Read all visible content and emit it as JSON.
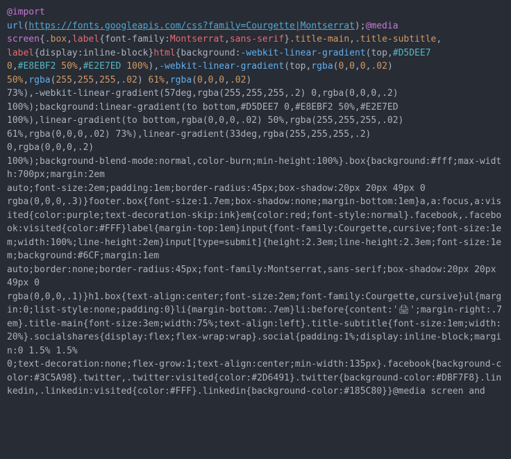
{
  "code": {
    "import_kw": "@import",
    "url_fn": "url",
    "url_str": "https://fonts.googleapis.com/css?family=Courgette|Montserrat",
    "media_kw": "@media",
    "screen_kw": "screen",
    "sel_box": ".box",
    "sel_label": "label",
    "font_family_prop": "font-family",
    "font_val_mont": "Montserrat",
    "font_val_sans": "sans-serif",
    "sel_title_main": ".title-main",
    "sel_title_sub": ".title-subtitle",
    "display_prop": "display",
    "inline_block": "inline-block",
    "sel_html": "html",
    "background_prop": "background",
    "webkit_lg": "-webkit-linear-gradient",
    "top": "top",
    "col_d5dee7": "#D5DEE7",
    "zero": "0",
    "col_e8ebf2": "#E8EBF2",
    "pct_50": "50%",
    "col_e2e7ed": "#E2E7ED",
    "pct_100": "100%",
    "rgba_fn": "rgba",
    "r0": "0",
    "r255": "255",
    "a02": ".02",
    "a2": ".2",
    "pct_61": "61%",
    "pct_73": "73%",
    "deg_57": "57deg",
    "linear_gradient": "linear-gradient",
    "to_bottom": "to bottom",
    "deg_33": "33deg",
    "bg_blend": "background-blend-mode",
    "normal": "normal",
    "color_burn": "color-burn",
    "min_height": "min-height",
    "bg_short": "background",
    "col_fff": "#fff",
    "max_width": "max-width",
    "px_700": "700px",
    "margin_prop": "margin",
    "em_2": "2em",
    "auto": "auto",
    "font_size_prop": "font-size",
    "padding_prop": "padding",
    "em_1": "1em",
    "border_radius": "border-radius",
    "px_45": "45px",
    "box_shadow": "box-shadow",
    "px_20": "20px",
    "px_49": "49px",
    "a3": ".3",
    "sel_footer_box": "footer.box",
    "em_17": "1.7em",
    "none": "none",
    "margin_bottom": "margin-bottom",
    "sel_a": "a",
    "sel_a_focus": "a:focus",
    "sel_a_visited": "a:visited",
    "color_prop": "color",
    "purple": "purple",
    "text_dec_skip": "text-decoration-skip",
    "ink": "ink",
    "sel_em": "em",
    "red": "red",
    "font_style": "font-style",
    "sel_facebook": ".facebook",
    "sel_facebook_vis": ".facebook:visited",
    "col_FFF": "#FFF",
    "margin_top": "margin-top",
    "sel_input": "input",
    "courgette": "Courgette",
    "cursive": "cursive",
    "width_prop": "width",
    "line_height": "line-height",
    "sel_submit": "input[type=submit]",
    "height_prop": "height",
    "em_23": "2.3em",
    "col_6cf": "#6CF",
    "border_prop": "border",
    "a1": ".1",
    "sel_h1box": "h1.box",
    "text_align": "text-align",
    "center": "center",
    "sel_ul": "ul",
    "list_style": "list-style",
    "sel_li": "li",
    "em_07": ".7em",
    "sel_li_before": "li:before",
    "content_prop": "content",
    "printer_emoji": "'🖨'",
    "margin_right": "margin-right",
    "em_3": "3em",
    "pct_75": "75%",
    "left": "left",
    "pct_20": "20%",
    "sel_socials": ".socialshares",
    "flex": "flex",
    "flex_wrap": "flex-wrap",
    "wrap": "wrap",
    "sel_social": ".social",
    "pct_1": "1%",
    "pct_15": "1.5%",
    "text_dec": "text-decoration",
    "flex_grow": "flex-grow",
    "one": "1",
    "min_width": "min-width",
    "px_135": "135px",
    "bg_color": "background-color",
    "col_3c5a98": "#3C5A98",
    "sel_twitter": ".twitter",
    "sel_twitter_vis": ".twitter:visited",
    "col_2d6491": "#2D6491",
    "col_dbf7f8": "#DBF7F8",
    "sel_linkedin": ".linkedin",
    "sel_linkedin_vis": ".linkedin:visited",
    "col_185c80": "#185C80",
    "and": "and"
  }
}
